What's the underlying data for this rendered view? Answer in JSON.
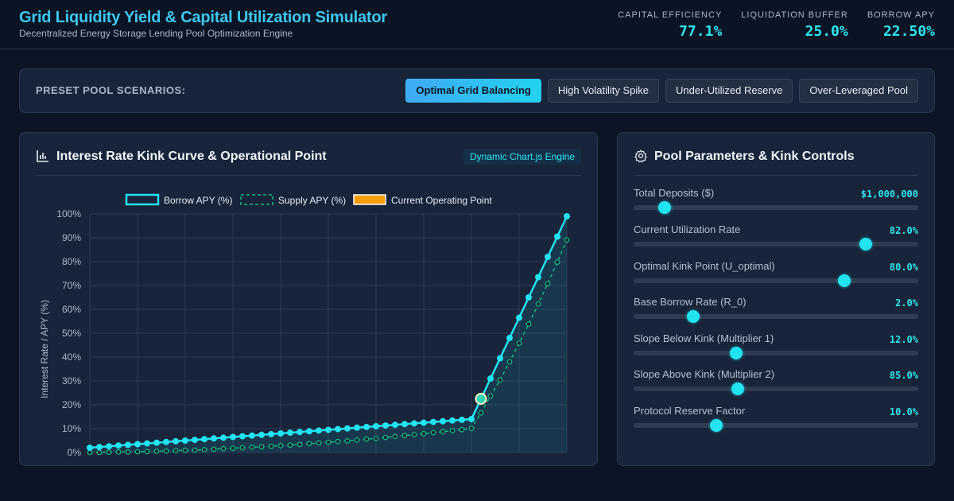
{
  "header": {
    "title": "Grid Liquidity Yield & Capital Utilization Simulator",
    "subtitle": "Decentralized Energy Storage Lending Pool Optimization Engine",
    "metrics": [
      {
        "label": "CAPITAL EFFICIENCY",
        "value": "77.1%"
      },
      {
        "label": "LIQUIDATION BUFFER",
        "value": "25.0%"
      },
      {
        "label": "BORROW APY",
        "value": "22.50%"
      }
    ]
  },
  "presets": {
    "label": "PRESET POOL SCENARIOS:",
    "buttons": [
      {
        "label": "Optimal Grid Balancing",
        "active": true
      },
      {
        "label": "High Volatility Spike",
        "active": false
      },
      {
        "label": "Under-Utilized Reserve",
        "active": false
      },
      {
        "label": "Over-Leveraged Pool",
        "active": false
      }
    ]
  },
  "chart_panel": {
    "title": "Interest Rate Kink Curve & Operational Point",
    "badge": "Dynamic Chart.js Engine",
    "icon": "bar-chart-icon"
  },
  "params_panel": {
    "title": "Pool Parameters & Kink Controls",
    "icon": "gear-icon",
    "params": [
      {
        "label": "Total Deposits ($)",
        "value": "$1,000,000",
        "fraction": 0.11
      },
      {
        "label": "Current Utilization Rate",
        "value": "82.0%",
        "fraction": 0.815
      },
      {
        "label": "Optimal Kink Point (U_optimal)",
        "value": "80.0%",
        "fraction": 0.74
      },
      {
        "label": "Base Borrow Rate (R_0)",
        "value": "2.0%",
        "fraction": 0.21
      },
      {
        "label": "Slope Below Kink (Multiplier 1)",
        "value": "12.0%",
        "fraction": 0.36
      },
      {
        "label": "Slope Above Kink (Multiplier 2)",
        "value": "85.0%",
        "fraction": 0.365
      },
      {
        "label": "Protocol Reserve Factor",
        "value": "10.0%",
        "fraction": 0.29
      }
    ]
  },
  "colors": {
    "accent": "#22e3f0",
    "supply": "#10b981",
    "operating_point": "#f59e0b"
  },
  "chart_data": {
    "type": "line",
    "ylabel": "Interest Rate / APY (%)",
    "ylim": [
      0,
      100
    ],
    "yticks": [
      "0%",
      "10%",
      "20%",
      "30%",
      "40%",
      "50%",
      "60%",
      "70%",
      "80%",
      "90%",
      "100%"
    ],
    "legend_position": "top",
    "x": [
      0,
      2,
      4,
      6,
      8,
      10,
      12,
      14,
      16,
      18,
      20,
      22,
      24,
      26,
      28,
      30,
      32,
      34,
      36,
      38,
      40,
      42,
      44,
      46,
      48,
      50,
      52,
      54,
      56,
      58,
      60,
      62,
      64,
      66,
      68,
      70,
      72,
      74,
      76,
      78,
      80,
      82,
      84,
      86,
      88,
      90,
      92,
      94,
      96,
      98,
      100
    ],
    "series": [
      {
        "name": "Borrow APY (%)",
        "style": "solid",
        "values": [
          2.0,
          2.3,
          2.6,
          2.9,
          3.2,
          3.5,
          3.8,
          4.1,
          4.4,
          4.7,
          5.0,
          5.3,
          5.6,
          5.9,
          6.2,
          6.5,
          6.8,
          7.1,
          7.4,
          7.7,
          8.0,
          8.3,
          8.6,
          8.9,
          9.2,
          9.5,
          9.8,
          10.1,
          10.4,
          10.7,
          11.0,
          11.3,
          11.6,
          11.9,
          12.2,
          12.5,
          12.8,
          13.1,
          13.4,
          13.7,
          14.0,
          22.5,
          31.0,
          39.5,
          48.0,
          56.5,
          65.0,
          73.5,
          82.0,
          90.5,
          99.0
        ]
      },
      {
        "name": "Supply APY (%)",
        "style": "dashed",
        "values": [
          0.0,
          0.0,
          0.1,
          0.2,
          0.2,
          0.3,
          0.4,
          0.5,
          0.6,
          0.8,
          0.9,
          1.0,
          1.2,
          1.4,
          1.6,
          1.8,
          2.0,
          2.2,
          2.4,
          2.6,
          2.9,
          3.1,
          3.4,
          3.7,
          4.0,
          4.3,
          4.6,
          4.9,
          5.2,
          5.6,
          5.9,
          6.3,
          6.7,
          7.1,
          7.5,
          7.9,
          8.3,
          8.7,
          9.2,
          9.6,
          10.1,
          16.6,
          23.7,
          30.4,
          38.0,
          45.8,
          53.8,
          62.2,
          70.8,
          79.8,
          89.1
        ]
      },
      {
        "name": "Current Operating Point",
        "style": "point",
        "x": [
          82
        ],
        "values": [
          22.5
        ]
      }
    ]
  }
}
